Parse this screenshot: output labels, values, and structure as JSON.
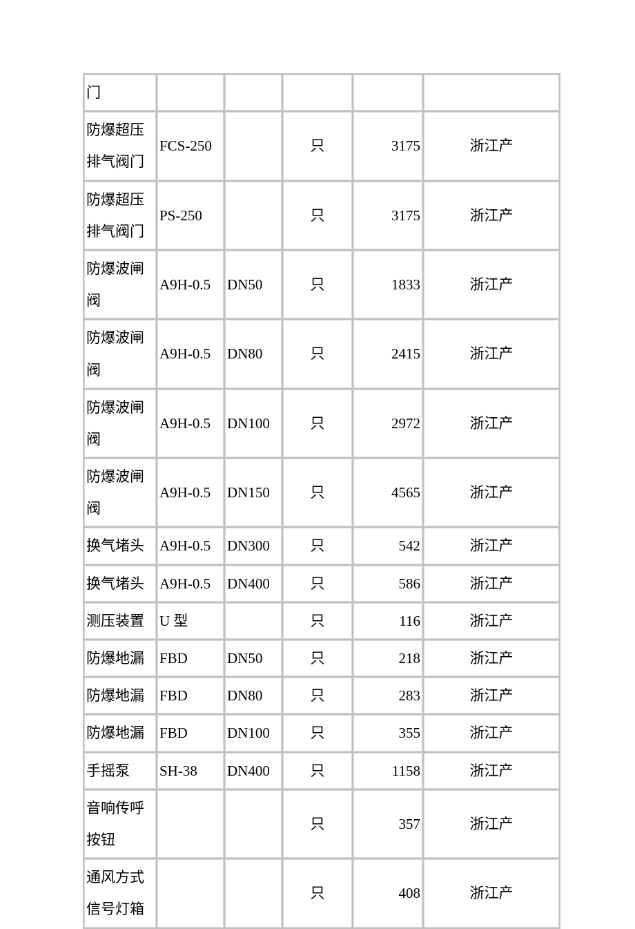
{
  "rows": [
    {
      "name": "门",
      "model": "",
      "spec": "",
      "unit": "",
      "price": "",
      "origin": ""
    },
    {
      "name": "防爆超压排气阀门",
      "model": "FCS-250",
      "spec": "",
      "unit": "只",
      "price": "3175",
      "origin": "浙江产"
    },
    {
      "name": "防爆超压排气阀门",
      "model": "PS-250",
      "spec": "",
      "unit": "只",
      "price": "3175",
      "origin": "浙江产"
    },
    {
      "name": "防爆波闸阀",
      "model": "A9H-0.5",
      "spec": "DN50",
      "unit": "只",
      "price": "1833",
      "origin": "浙江产"
    },
    {
      "name": "防爆波闸阀",
      "model": "A9H-0.5",
      "spec": "DN80",
      "unit": "只",
      "price": "2415",
      "origin": "浙江产"
    },
    {
      "name": "防爆波闸阀",
      "model": "A9H-0.5",
      "spec": "DN100",
      "unit": "只",
      "price": "2972",
      "origin": "浙江产"
    },
    {
      "name": "防爆波闸阀",
      "model": "A9H-0.5",
      "spec": "DN150",
      "unit": "只",
      "price": "4565",
      "origin": "浙江产"
    },
    {
      "name": "换气堵头",
      "model": "A9H-0.5",
      "spec": "DN300",
      "unit": "只",
      "price": "542",
      "origin": "浙江产"
    },
    {
      "name": "换气堵头",
      "model": "A9H-0.5",
      "spec": "DN400",
      "unit": "只",
      "price": "586",
      "origin": "浙江产"
    },
    {
      "name": "测压装置",
      "model": "U 型",
      "spec": "",
      "unit": "只",
      "price": "116",
      "origin": "浙江产"
    },
    {
      "name": "防爆地漏",
      "model": "FBD",
      "spec": "DN50",
      "unit": "只",
      "price": "218",
      "origin": "浙江产"
    },
    {
      "name": "防爆地漏",
      "model": "FBD",
      "spec": "DN80",
      "unit": "只",
      "price": "283",
      "origin": "浙江产"
    },
    {
      "name": "防爆地漏",
      "model": "FBD",
      "spec": "DN100",
      "unit": "只",
      "price": "355",
      "origin": "浙江产"
    },
    {
      "name": "手摇泵",
      "model": "SH-38",
      "spec": "DN400",
      "unit": "只",
      "price": "1158",
      "origin": "浙江产"
    },
    {
      "name": "音响传呼按钮",
      "model": "",
      "spec": "",
      "unit": "只",
      "price": "357",
      "origin": "浙江产"
    },
    {
      "name": "通风方式信号灯箱",
      "model": "",
      "spec": "",
      "unit": "只",
      "price": "408",
      "origin": "浙江产"
    }
  ]
}
